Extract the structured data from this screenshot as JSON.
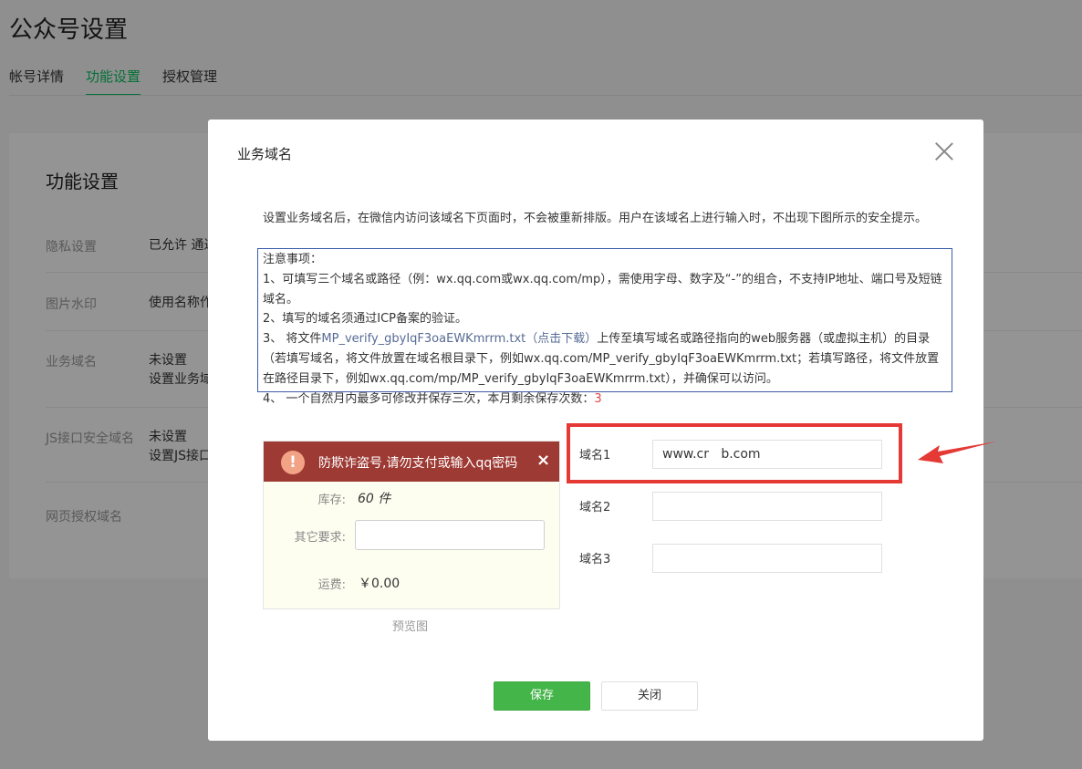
{
  "page": {
    "title": "公众号设置",
    "tabs": [
      "帐号详情",
      "功能设置",
      "授权管理"
    ],
    "active_tab": "功能设置"
  },
  "panel": {
    "title": "功能设置",
    "rows": [
      {
        "label": "隐私设置",
        "value": "已允许 通过"
      },
      {
        "label": "图片水印",
        "value": "使用名称作"
      },
      {
        "label": "业务域名",
        "value": "未设置",
        "value2": "设置业务域"
      },
      {
        "label": "JS接口安全域名",
        "value": "未设置",
        "value2": "设置JS接口"
      },
      {
        "label": "网页授权域名",
        "value": ""
      }
    ]
  },
  "dialog": {
    "title": "业务域名",
    "intro": "设置业务域名后，在微信内访问该域名下页面时，不会被重新排版。用户在该域名上进行输入时，不出现下图所示的安全提示。",
    "notice": {
      "heading": "注意事项：",
      "item1": "1、可填写三个域名或路径（例：wx.qq.com或wx.qq.com/mp），需使用字母、数字及“-”的组合，不支持IP地址、端口号及短链域名。",
      "item2": "2、填写的域名须通过ICP备案的验证。",
      "item3_prefix": "3、 将文件",
      "item3_file": "MP_verify_gbyIqF3oaEWKmrrm.txt",
      "item3_download": "（点击下载）",
      "item3_suffix": "上传至填写域名或路径指向的web服务器（或虚拟主机）的目录（若填写域名，将文件放置在域名根目录下，例如wx.qq.com/MP_verify_gbyIqF3oaEWKmrrm.txt；若填写路径，将文件放置在路径目录下，例如wx.qq.com/mp/MP_verify_gbyIqF3oaEWKmrrm.txt），并确保可以访问。"
    },
    "item4_prefix": "4、 一个自然月内最多可修改并保存三次，本月剩余保存次数：",
    "item4_count": "3",
    "preview": {
      "toast": "防欺诈盗号,请勿支付或输入qq密码",
      "toast_close": "×",
      "stock_label": "库存:",
      "stock_value": "60 件",
      "other_label": "其它要求:",
      "fee_label": "运费:",
      "fee_value": "￥0.00",
      "caption": "预览图"
    },
    "domains": [
      {
        "label": "域名1",
        "value": "www.cr   b.com"
      },
      {
        "label": "域名2",
        "value": ""
      },
      {
        "label": "域名3",
        "value": ""
      }
    ],
    "save_label": "保存",
    "close_label": "关闭"
  },
  "colors": {
    "accent_green": "#07c160",
    "button_green": "#44b549",
    "highlight_red": "#e53935",
    "link_blue": "#576b95",
    "toast_bg": "#9e3a34"
  },
  "icons": [
    "close-icon",
    "warning-icon",
    "red-arrow-icon"
  ]
}
